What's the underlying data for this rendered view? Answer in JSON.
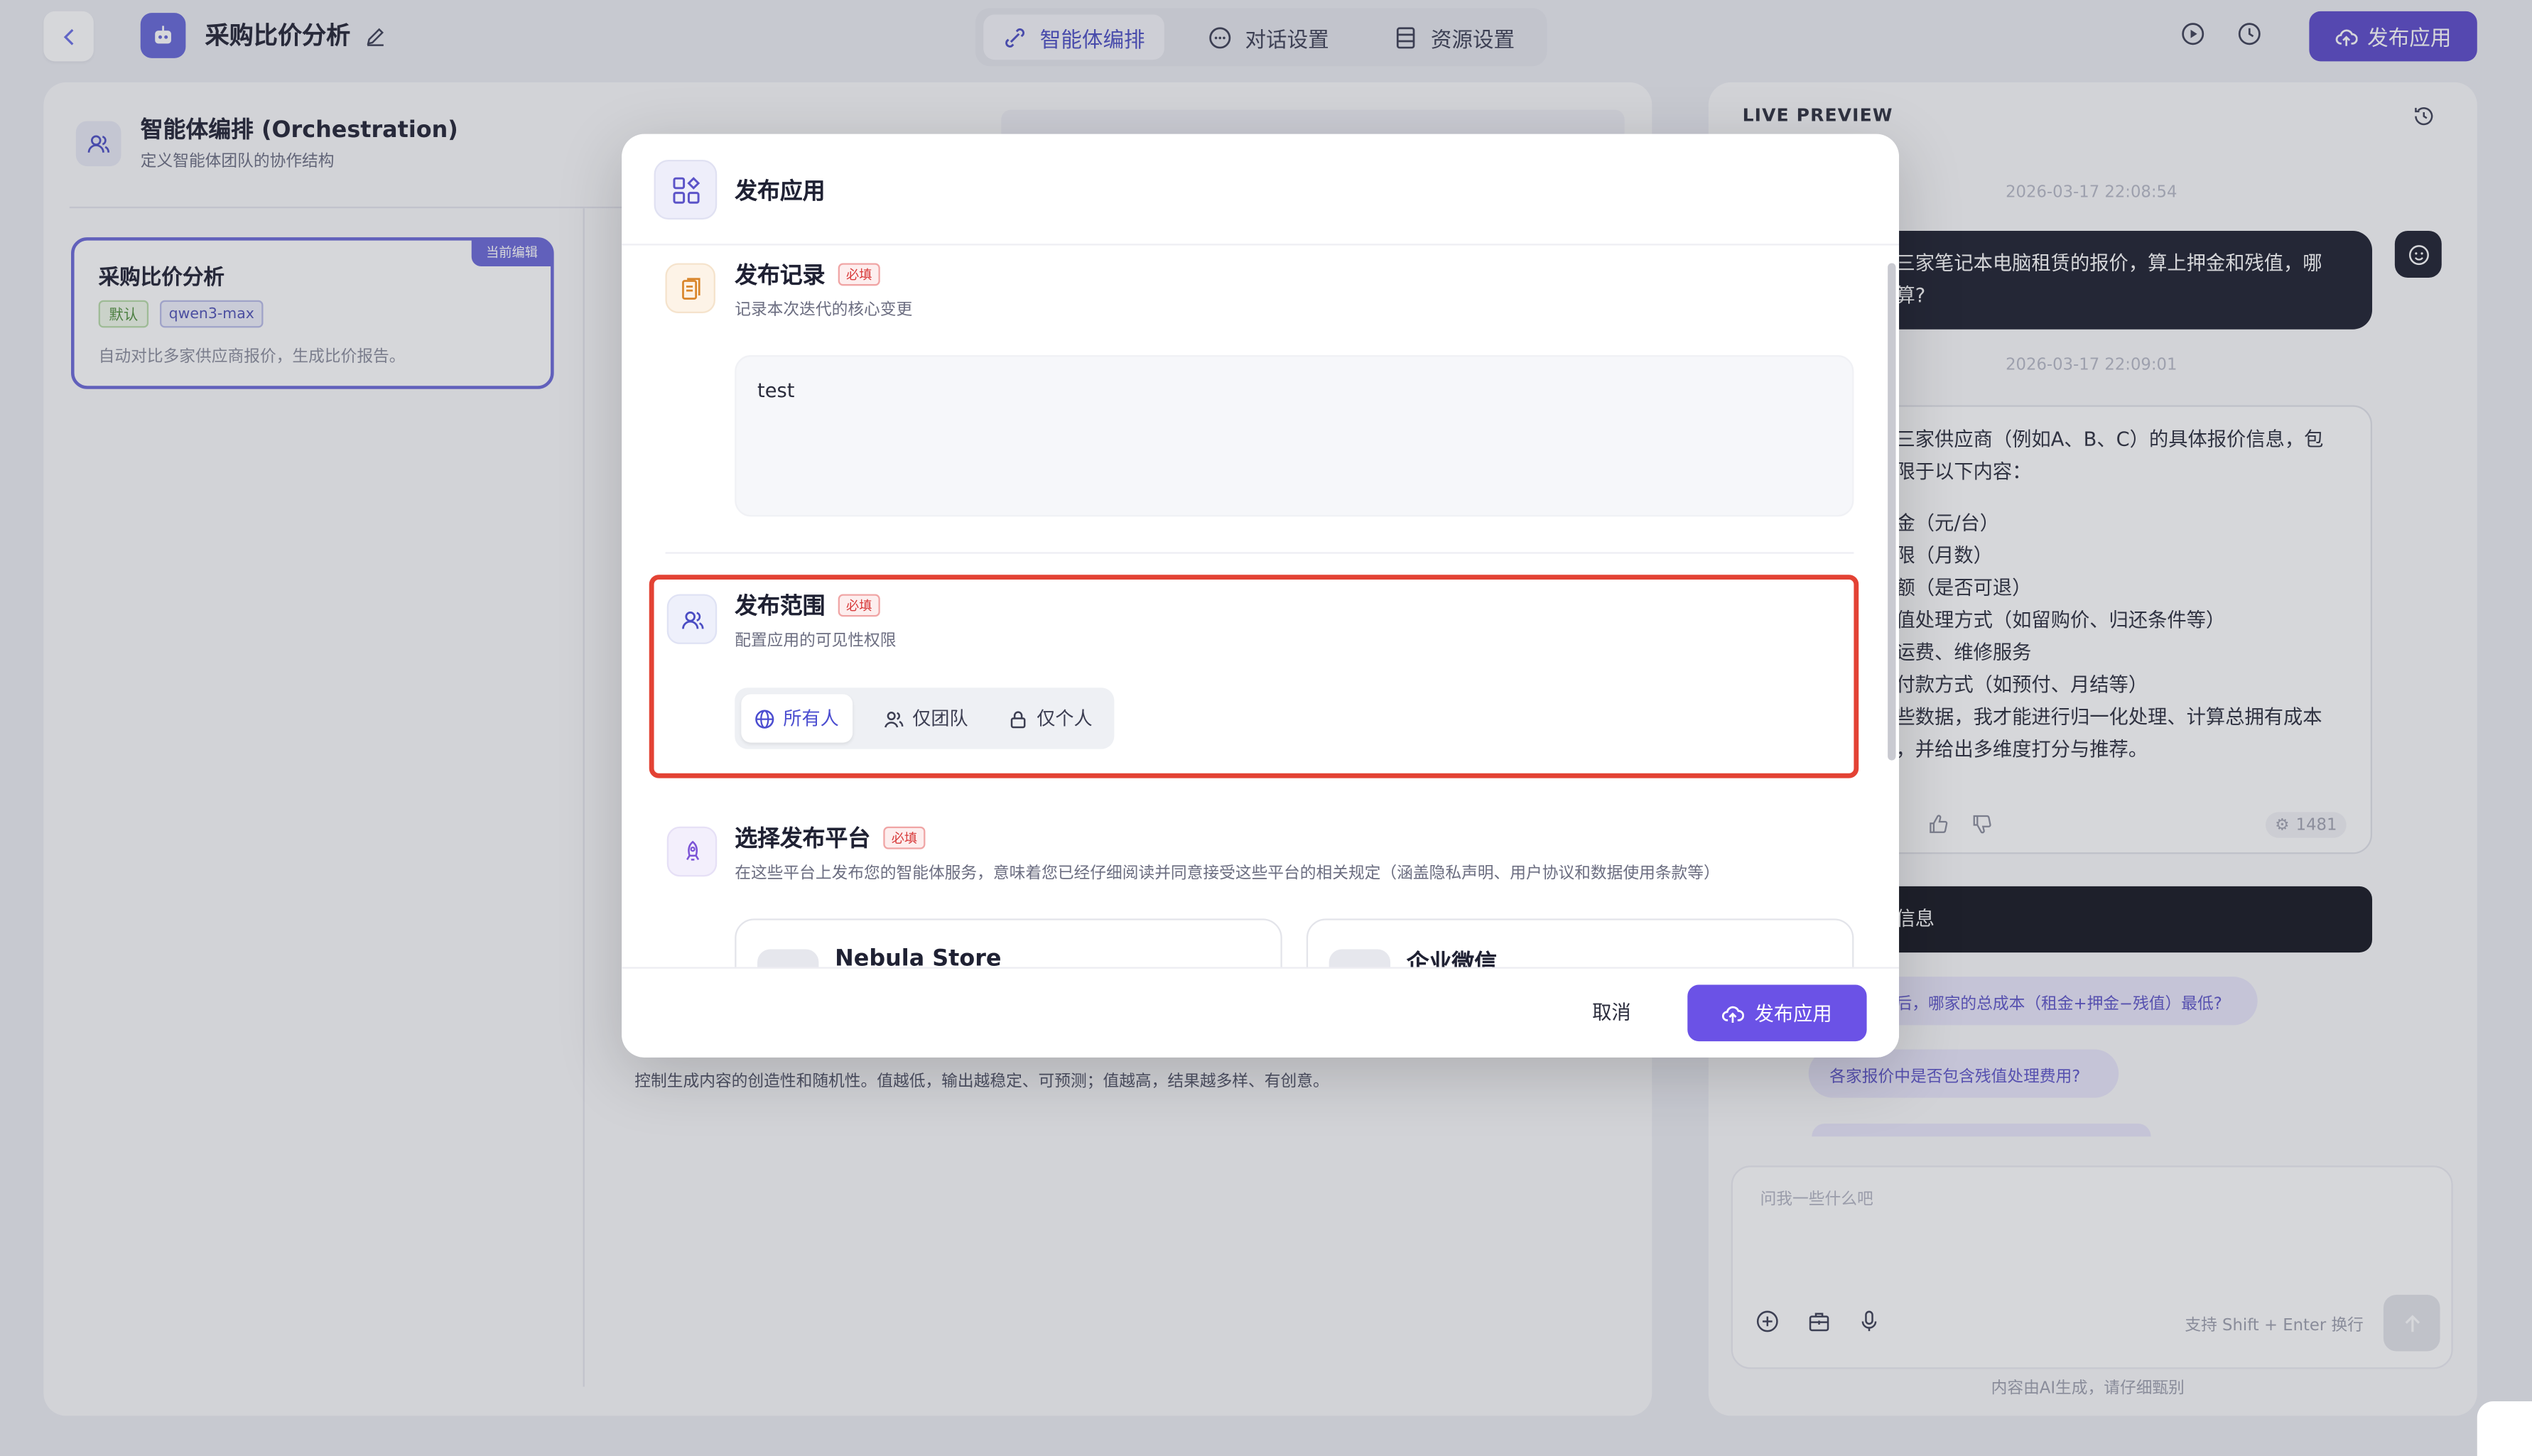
{
  "header": {
    "back_icon": "chevron-left-icon",
    "app_icon": "robot-icon",
    "title": "采购比价分析",
    "edit_icon": "pencil-icon",
    "tabs": [
      {
        "label": "智能体编排",
        "icon": "link-icon",
        "active": true
      },
      {
        "label": "对话设置",
        "icon": "chat-icon",
        "active": false
      },
      {
        "label": "资源设置",
        "icon": "list-icon",
        "active": false
      }
    ],
    "run_icon": "play-icon",
    "history_icon": "clock-icon",
    "publish_label": "发布应用",
    "accent_color": "#5a48c9"
  },
  "orchestration": {
    "title": "智能体编排 (Orchestration)",
    "subtitle": "定义智能体团队的协作结构",
    "agent": {
      "badge": "当前编辑",
      "name": "采购比价分析",
      "tag_default": "默认",
      "tag_model": "qwen3-max",
      "description": "自动对比多家供应商报价，生成比价报告。"
    },
    "hint": "控制生成内容的创造性和随机性。值越低，输出越稳定、可预测；值越高，结果越多样、有创意。"
  },
  "preview": {
    "title": "LIVE PREVIEW",
    "timestamp1": "2026-03-17 22:08:54",
    "user_message": [
      "三家笔记本电脑租赁的报价，算上押金和残值，哪",
      "算?"
    ],
    "timestamp2": "2026-03-17 22:09:01",
    "ai_lines": [
      "三家供应商（例如A、B、C）的具体报价信息，包",
      "限于以下内容：",
      "金（元/台）",
      "限（月数）",
      "额（是否可退）",
      "值处理方式（如留购价、归还条件等）",
      "运费、维修服务",
      "付款方式（如预付、月结等）",
      "些数据，我才能进行归一化处理、计算总拥有成本",
      "，并给出多维度打分与推荐。"
    ],
    "token_count": "1481",
    "dark_bar_text": "信息",
    "chips": [
      "后，哪家的总成本（租金+押金−残值）最低?",
      "各家报价中是否包含残值处理费用?"
    ],
    "input_placeholder": "问我一些什么吧",
    "shift_hint": "支持 Shift + Enter 换行",
    "ai_note": "内容由AI生成，请仔细甄别"
  },
  "modal": {
    "title": "发布应用",
    "required_label": "必填",
    "record": {
      "title": "发布记录",
      "subtitle": "记录本次迭代的核心变更",
      "value": "test"
    },
    "scope": {
      "title": "发布范围",
      "subtitle": "配置应用的可见性权限",
      "options": [
        "所有人",
        "仅团队",
        "仅个人"
      ],
      "selected": "所有人"
    },
    "platform": {
      "title": "选择发布平台",
      "subtitle": "在这些平台上发布您的智能体服务，意味着您已经仔细阅读并同意接受这些平台的相关规定（涵盖隐私声明、用户协议和数据使用条款等）",
      "cards": [
        "Nebula Store",
        "企业微信"
      ]
    },
    "cancel_label": "取消",
    "publish_label": "发布应用",
    "highlight_color": "#e34234"
  }
}
